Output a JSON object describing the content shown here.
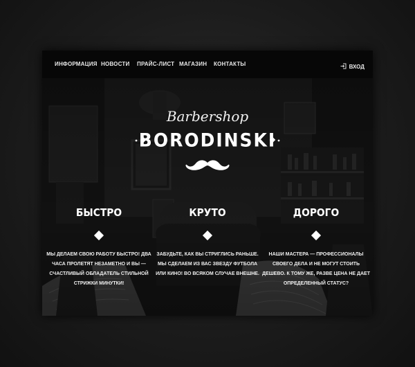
{
  "nav": {
    "items": [
      {
        "label": "ИНФОРМАЦИЯ"
      },
      {
        "label": "НОВОСТИ"
      },
      {
        "label": "ПРАЙС-ЛИСТ"
      },
      {
        "label": "МАГАЗИН"
      },
      {
        "label": "КОНТАКТЫ"
      }
    ],
    "login_label": "ВХОД",
    "login_icon": "login-icon"
  },
  "hero": {
    "script_title": "Barbershop",
    "brand": "BORODINSKI",
    "logo_icon": "mustache-icon"
  },
  "features": [
    {
      "title": "БЫСТРО",
      "text": "МЫ ДЕЛАЕМ СВОЮ РАБОТУ БЫСТРО! ДВА ЧАСА ПРОЛЕТЯТ НЕЗАМЕТНО И ВЫ — СЧАСТЛИВЫЙ ОБЛАДАТЕЛЬ СТИЛЬНОЙ СТРИЖКИ МИНУТКИ!"
    },
    {
      "title": "КРУТО",
      "text": "ЗАБУДЬТЕ, КАК ВЫ СТРИГЛИСЬ РАНЬШЕ. МЫ СДЕЛАЕМ ИЗ ВАС ЗВЕЗДУ ФУТБОЛА ИЛИ КИНО! ВО ВСЯКОМ СЛУЧАЕ ВНЕШНЕ."
    },
    {
      "title": "ДОРОГО",
      "text": "НАШИ МАСТЕРА — ПРОФЕССИОНАЛЫ СВОЕГО ДЕЛА И НЕ МОГУТ СТОИТЬ ДЕШЕВО. К ТОМУ ЖЕ, РАЗВЕ ЦЕНА НЕ ДАЕТ ОПРЕДЕЛЕННЫЙ СТАТУС?"
    }
  ],
  "colors": {
    "background": "#1c1c1c",
    "nav": "#070707",
    "text": "#ffffff"
  }
}
